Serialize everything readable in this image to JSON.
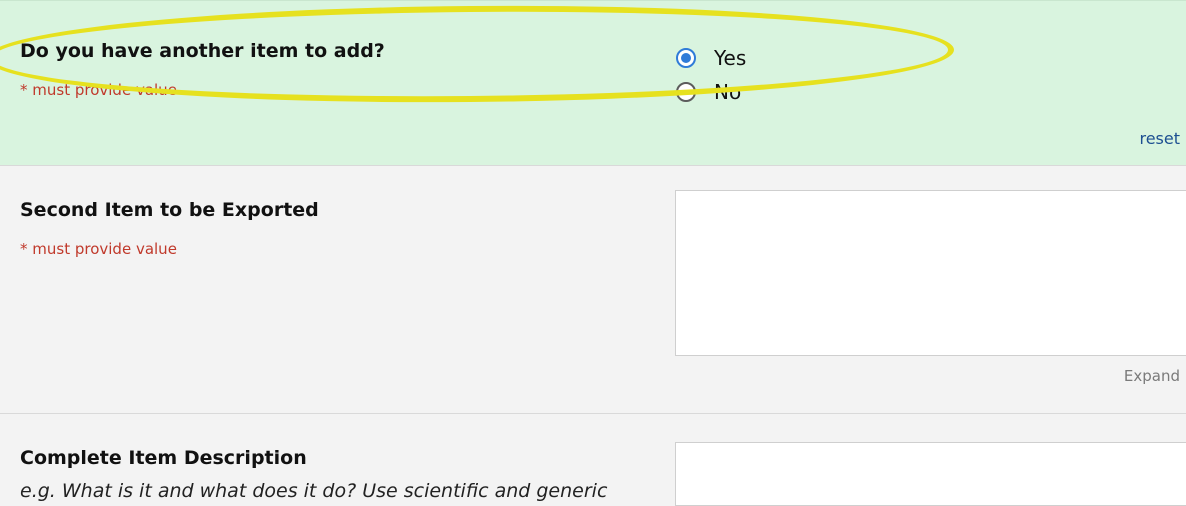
{
  "question_1": {
    "label": "Do you have another item to add?",
    "required": "* must provide value",
    "options": [
      {
        "label": "Yes",
        "selected": true
      },
      {
        "label": "No",
        "selected": false
      }
    ],
    "reset": "reset"
  },
  "question_2": {
    "label": "Second Item to be Exported",
    "required": "* must provide value",
    "expand": "Expand"
  },
  "question_3": {
    "label": "Complete Item Description",
    "note": "e.g. What is it and what does it do? Use scientific and generic"
  },
  "colors": {
    "highlight": "#e6e11f",
    "active_row_bg": "#d9f4df",
    "row_bg": "#f3f3f3",
    "required_text": "#c0392b",
    "radio_selected": "#2f7bd8",
    "link": "#1d4f91"
  }
}
